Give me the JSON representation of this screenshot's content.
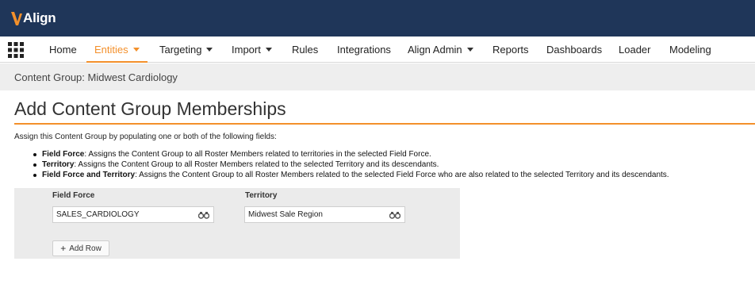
{
  "app": {
    "logo_text": "Align"
  },
  "nav": {
    "items": [
      {
        "label": "Home",
        "has_caret": false,
        "active": false
      },
      {
        "label": "Entities",
        "has_caret": true,
        "active": true
      },
      {
        "label": "Targeting",
        "has_caret": true,
        "active": false
      },
      {
        "label": "Import",
        "has_caret": true,
        "active": false
      },
      {
        "label": "Rules",
        "has_caret": false,
        "active": false
      },
      {
        "label": "Integrations",
        "has_caret": false,
        "active": false
      },
      {
        "label": "Align Admin",
        "has_caret": true,
        "active": false
      },
      {
        "label": "Reports",
        "has_caret": false,
        "active": false
      },
      {
        "label": "Dashboards",
        "has_caret": false,
        "active": false
      },
      {
        "label": "Loader",
        "has_caret": false,
        "active": false
      },
      {
        "label": "Modeling",
        "has_caret": false,
        "active": false
      }
    ]
  },
  "breadcrumb": {
    "text": "Content Group: Midwest Cardiology"
  },
  "page": {
    "title": "Add Content Group Memberships",
    "intro": "Assign this Content Group by populating one or both of the following fields:",
    "bullets": [
      {
        "term": "Field Force",
        "desc": ": Assigns the Content Group to all Roster Members related to territories in the selected Field Force."
      },
      {
        "term": "Territory",
        "desc": ": Assigns the Content Group to all Roster Members related to the selected Territory and its descendants."
      },
      {
        "term": "Field Force and Territory",
        "desc": ": Assigns the Content Group to all Roster Members related to the selected Field Force who are also related to the selected Territory and its descendants."
      }
    ]
  },
  "form": {
    "field_force_label": "Field Force",
    "territory_label": "Territory",
    "field_force_value": "SALES_CARDIOLOGY",
    "territory_value": "Midwest Sale Region",
    "add_row_label": "Add Row"
  },
  "colors": {
    "header_bg": "#1f3659",
    "accent": "#f3902b",
    "panel_bg": "#ebebeb"
  },
  "icons": [
    "apps-grid-icon",
    "caret-down-icon",
    "binoculars-icon",
    "plus-icon"
  ]
}
